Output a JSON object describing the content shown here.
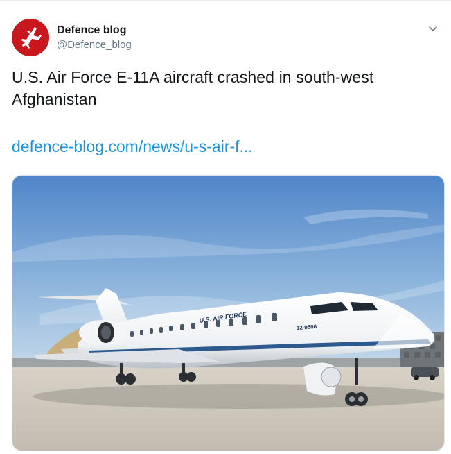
{
  "author": {
    "display_name": "Defence blog",
    "handle": "@Defence_blog"
  },
  "tweet": {
    "text": "U.S. Air Force E-11A aircraft crashed in south-west Afghanistan",
    "link": "defence-blog.com/news/u-s-air-f..."
  },
  "icons": {
    "avatar": "fighter-jet-logo",
    "caret": "chevron-down-icon"
  },
  "media": {
    "aircraft_markings": {
      "fuselage_title": "U.S. AIR FORCE",
      "tail_number": "12-9506"
    }
  },
  "colors": {
    "link": "#1b95e0",
    "avatar_bg": "#c8181e",
    "text": "#14171a",
    "secondary": "#657786"
  }
}
